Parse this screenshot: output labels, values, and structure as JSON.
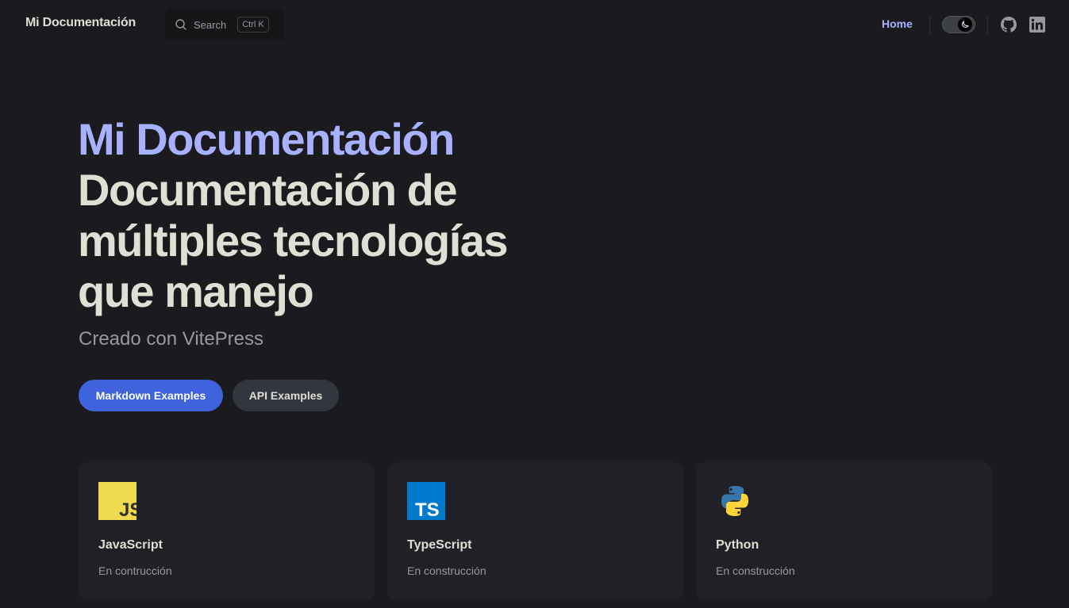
{
  "nav": {
    "brand": "Mi Documentación",
    "search_label": "Search",
    "search_shortcut": "Ctrl K",
    "links": [
      {
        "label": "Home",
        "active": true
      }
    ],
    "theme": "dark",
    "social": [
      "github-icon",
      "linkedin-icon"
    ]
  },
  "hero": {
    "name": "Mi Documentación",
    "text": "Documentación de múltiples tecnologías que manejo",
    "tagline": "Creado con VitePress",
    "actions": [
      {
        "label": "Markdown Examples",
        "theme": "brand"
      },
      {
        "label": "API Examples",
        "theme": "alt"
      }
    ]
  },
  "features": [
    {
      "icon": "javascript-logo-icon",
      "title": "JavaScript",
      "details": "En contrucción"
    },
    {
      "icon": "typescript-logo-icon",
      "title": "TypeScript",
      "details": "En construcción"
    },
    {
      "icon": "python-logo-icon",
      "title": "Python",
      "details": "En construcción"
    }
  ],
  "colors": {
    "background": "#1b1b1f",
    "brand": "#a8b1ff",
    "button_brand": "#3e63dd",
    "button_alt": "#32363f",
    "card": "#202127",
    "text_muted": "#98989f"
  }
}
